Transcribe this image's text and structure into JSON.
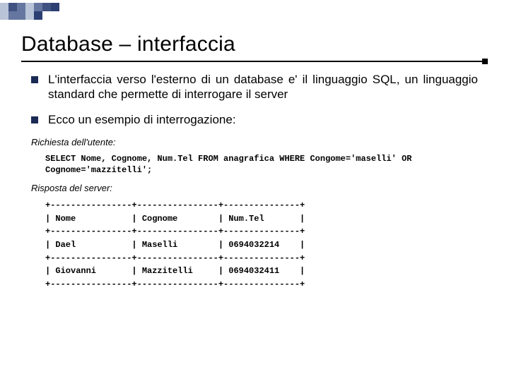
{
  "deco_colors": [
    "#b9c4d8",
    "#2b3f73",
    "#6576a0",
    "#b9c4d8",
    "#6576a0",
    "#2b3f73",
    "#2b3f73",
    "#b9c4d8",
    "#6576a0",
    "#6576a0",
    "#b9c4d8",
    "#2b3f73"
  ],
  "title": "Database – interfaccia",
  "bullets": [
    "L'interfaccia verso l'esterno di un database e' il linguaggio SQL, un linguaggio standard che permette di interrogare il server",
    "Ecco un esempio di interrogazione:"
  ],
  "request_label": "Richiesta dell'utente:",
  "sql_line1": "SELECT Nome, Cognome, Num.Tel FROM anagrafica WHERE Congome='maselli' OR",
  "sql_line2": "Cognome='mazzitelli';",
  "response_label": "Risposta del server:",
  "table_lines": [
    "+----------------+----------------+---------------+",
    "| Nome           | Cognome        | Num.Tel       |",
    "+----------------+----------------+---------------+",
    "| Dael           | Maselli        | 0694032214    |",
    "+----------------+----------------+---------------+",
    "| Giovanni       | Mazzitelli     | 0694032411    |",
    "+----------------+----------------+---------------+"
  ]
}
